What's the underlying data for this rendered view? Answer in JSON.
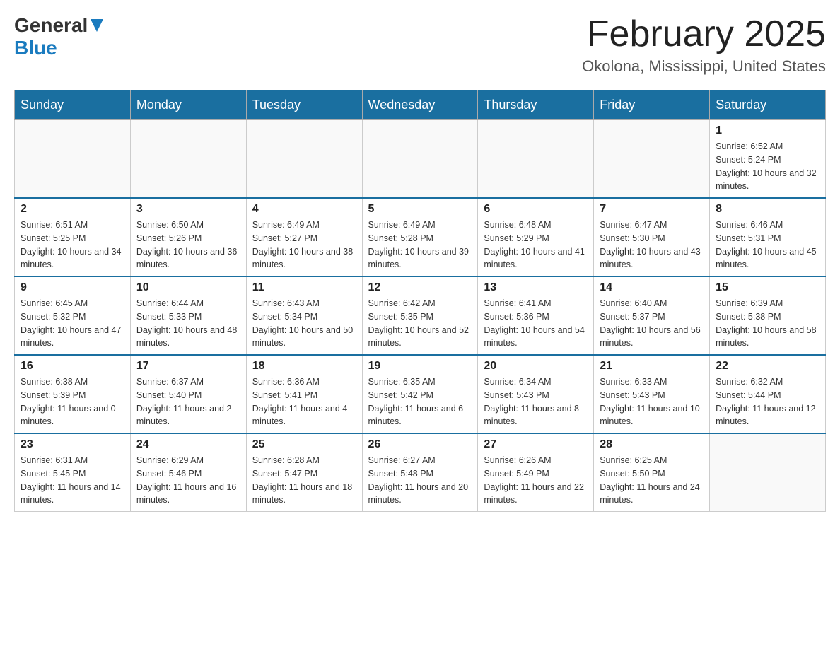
{
  "header": {
    "logo_general": "General",
    "logo_blue": "Blue",
    "month_title": "February 2025",
    "location": "Okolona, Mississippi, United States"
  },
  "days_of_week": [
    "Sunday",
    "Monday",
    "Tuesday",
    "Wednesday",
    "Thursday",
    "Friday",
    "Saturday"
  ],
  "weeks": [
    [
      {
        "day": "",
        "sunrise": "",
        "sunset": "",
        "daylight": ""
      },
      {
        "day": "",
        "sunrise": "",
        "sunset": "",
        "daylight": ""
      },
      {
        "day": "",
        "sunrise": "",
        "sunset": "",
        "daylight": ""
      },
      {
        "day": "",
        "sunrise": "",
        "sunset": "",
        "daylight": ""
      },
      {
        "day": "",
        "sunrise": "",
        "sunset": "",
        "daylight": ""
      },
      {
        "day": "",
        "sunrise": "",
        "sunset": "",
        "daylight": ""
      },
      {
        "day": "1",
        "sunrise": "Sunrise: 6:52 AM",
        "sunset": "Sunset: 5:24 PM",
        "daylight": "Daylight: 10 hours and 32 minutes."
      }
    ],
    [
      {
        "day": "2",
        "sunrise": "Sunrise: 6:51 AM",
        "sunset": "Sunset: 5:25 PM",
        "daylight": "Daylight: 10 hours and 34 minutes."
      },
      {
        "day": "3",
        "sunrise": "Sunrise: 6:50 AM",
        "sunset": "Sunset: 5:26 PM",
        "daylight": "Daylight: 10 hours and 36 minutes."
      },
      {
        "day": "4",
        "sunrise": "Sunrise: 6:49 AM",
        "sunset": "Sunset: 5:27 PM",
        "daylight": "Daylight: 10 hours and 38 minutes."
      },
      {
        "day": "5",
        "sunrise": "Sunrise: 6:49 AM",
        "sunset": "Sunset: 5:28 PM",
        "daylight": "Daylight: 10 hours and 39 minutes."
      },
      {
        "day": "6",
        "sunrise": "Sunrise: 6:48 AM",
        "sunset": "Sunset: 5:29 PM",
        "daylight": "Daylight: 10 hours and 41 minutes."
      },
      {
        "day": "7",
        "sunrise": "Sunrise: 6:47 AM",
        "sunset": "Sunset: 5:30 PM",
        "daylight": "Daylight: 10 hours and 43 minutes."
      },
      {
        "day": "8",
        "sunrise": "Sunrise: 6:46 AM",
        "sunset": "Sunset: 5:31 PM",
        "daylight": "Daylight: 10 hours and 45 minutes."
      }
    ],
    [
      {
        "day": "9",
        "sunrise": "Sunrise: 6:45 AM",
        "sunset": "Sunset: 5:32 PM",
        "daylight": "Daylight: 10 hours and 47 minutes."
      },
      {
        "day": "10",
        "sunrise": "Sunrise: 6:44 AM",
        "sunset": "Sunset: 5:33 PM",
        "daylight": "Daylight: 10 hours and 48 minutes."
      },
      {
        "day": "11",
        "sunrise": "Sunrise: 6:43 AM",
        "sunset": "Sunset: 5:34 PM",
        "daylight": "Daylight: 10 hours and 50 minutes."
      },
      {
        "day": "12",
        "sunrise": "Sunrise: 6:42 AM",
        "sunset": "Sunset: 5:35 PM",
        "daylight": "Daylight: 10 hours and 52 minutes."
      },
      {
        "day": "13",
        "sunrise": "Sunrise: 6:41 AM",
        "sunset": "Sunset: 5:36 PM",
        "daylight": "Daylight: 10 hours and 54 minutes."
      },
      {
        "day": "14",
        "sunrise": "Sunrise: 6:40 AM",
        "sunset": "Sunset: 5:37 PM",
        "daylight": "Daylight: 10 hours and 56 minutes."
      },
      {
        "day": "15",
        "sunrise": "Sunrise: 6:39 AM",
        "sunset": "Sunset: 5:38 PM",
        "daylight": "Daylight: 10 hours and 58 minutes."
      }
    ],
    [
      {
        "day": "16",
        "sunrise": "Sunrise: 6:38 AM",
        "sunset": "Sunset: 5:39 PM",
        "daylight": "Daylight: 11 hours and 0 minutes."
      },
      {
        "day": "17",
        "sunrise": "Sunrise: 6:37 AM",
        "sunset": "Sunset: 5:40 PM",
        "daylight": "Daylight: 11 hours and 2 minutes."
      },
      {
        "day": "18",
        "sunrise": "Sunrise: 6:36 AM",
        "sunset": "Sunset: 5:41 PM",
        "daylight": "Daylight: 11 hours and 4 minutes."
      },
      {
        "day": "19",
        "sunrise": "Sunrise: 6:35 AM",
        "sunset": "Sunset: 5:42 PM",
        "daylight": "Daylight: 11 hours and 6 minutes."
      },
      {
        "day": "20",
        "sunrise": "Sunrise: 6:34 AM",
        "sunset": "Sunset: 5:43 PM",
        "daylight": "Daylight: 11 hours and 8 minutes."
      },
      {
        "day": "21",
        "sunrise": "Sunrise: 6:33 AM",
        "sunset": "Sunset: 5:43 PM",
        "daylight": "Daylight: 11 hours and 10 minutes."
      },
      {
        "day": "22",
        "sunrise": "Sunrise: 6:32 AM",
        "sunset": "Sunset: 5:44 PM",
        "daylight": "Daylight: 11 hours and 12 minutes."
      }
    ],
    [
      {
        "day": "23",
        "sunrise": "Sunrise: 6:31 AM",
        "sunset": "Sunset: 5:45 PM",
        "daylight": "Daylight: 11 hours and 14 minutes."
      },
      {
        "day": "24",
        "sunrise": "Sunrise: 6:29 AM",
        "sunset": "Sunset: 5:46 PM",
        "daylight": "Daylight: 11 hours and 16 minutes."
      },
      {
        "day": "25",
        "sunrise": "Sunrise: 6:28 AM",
        "sunset": "Sunset: 5:47 PM",
        "daylight": "Daylight: 11 hours and 18 minutes."
      },
      {
        "day": "26",
        "sunrise": "Sunrise: 6:27 AM",
        "sunset": "Sunset: 5:48 PM",
        "daylight": "Daylight: 11 hours and 20 minutes."
      },
      {
        "day": "27",
        "sunrise": "Sunrise: 6:26 AM",
        "sunset": "Sunset: 5:49 PM",
        "daylight": "Daylight: 11 hours and 22 minutes."
      },
      {
        "day": "28",
        "sunrise": "Sunrise: 6:25 AM",
        "sunset": "Sunset: 5:50 PM",
        "daylight": "Daylight: 11 hours and 24 minutes."
      },
      {
        "day": "",
        "sunrise": "",
        "sunset": "",
        "daylight": ""
      }
    ]
  ]
}
